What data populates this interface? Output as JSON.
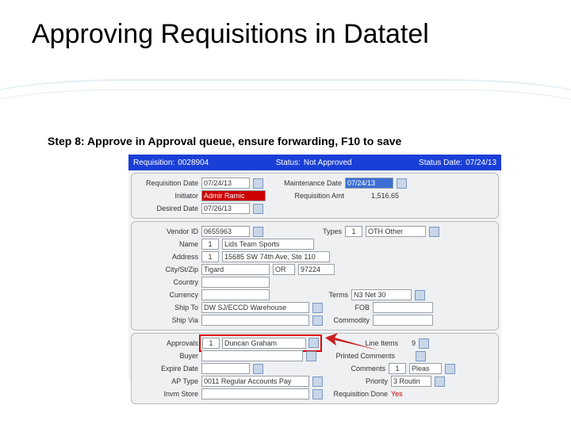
{
  "page": {
    "title": "Approving Requisitions in Datatel",
    "step_text": "Step 8: Approve in Approval queue, ensure forwarding, F10 to save"
  },
  "header": {
    "req_label": "Requisition:",
    "req_val": "0028904",
    "status_label": "Status:",
    "status_val": "Not Approved",
    "status_date_label": "Status Date:",
    "status_date_val": "07/24/13"
  },
  "sec1": {
    "req_date_lbl": "Requisition Date",
    "req_date": "07/24/13",
    "initiator_lbl": "Initiator",
    "initiator": "Admir Ramic",
    "desired_lbl": "Desired Date",
    "desired": "07/26/13",
    "maint_lbl": "Maintenance Date",
    "maint": "07/24/13",
    "amt_lbl": "Requisition Amt",
    "amt": "1,516.65"
  },
  "sec2": {
    "vendor_lbl": "Vendor ID",
    "vendor": "0655963",
    "name_lbl": "Name",
    "name_idx": "1",
    "name": "Lids Team Sports",
    "addr_lbl": "Address",
    "addr_idx": "1",
    "addr": "15685 SW 74th Ave, Ste 110",
    "city_lbl": "City/St/Zip",
    "city": "Tigard",
    "state": "OR",
    "zip": "97224",
    "country_lbl": "Country",
    "currency_lbl": "Currency",
    "shipto_lbl": "Ship To",
    "shipto": "DW SJ/ECCD Warehouse",
    "shipvia_lbl": "Ship Via",
    "types_lbl": "Types",
    "types_idx": "1",
    "types": "OTH Other",
    "terms_lbl": "Terms",
    "terms": "N3 Net 30",
    "fob_lbl": "FOB",
    "commodity_lbl": "Commodity"
  },
  "sec3": {
    "approvals_lbl": "Approvals",
    "approvals_idx": "1",
    "approvals": "Duncan Graham",
    "buyer_lbl": "Buyer",
    "expire_lbl": "Expire Date",
    "aptype_lbl": "AP Type",
    "aptype": "0011 Regular Accounts Pay",
    "invm_lbl": "Invm Store",
    "lineitems_lbl": "Line Items",
    "lineitems": "9",
    "printed_lbl": "Printed Comments",
    "comments_lbl": "Comments",
    "comments_idx": "1",
    "comments": "Pleas",
    "priority_lbl": "Priority",
    "priority": "3 Routin",
    "reqdone_lbl": "Requisition Done",
    "reqdone": "Yes"
  }
}
